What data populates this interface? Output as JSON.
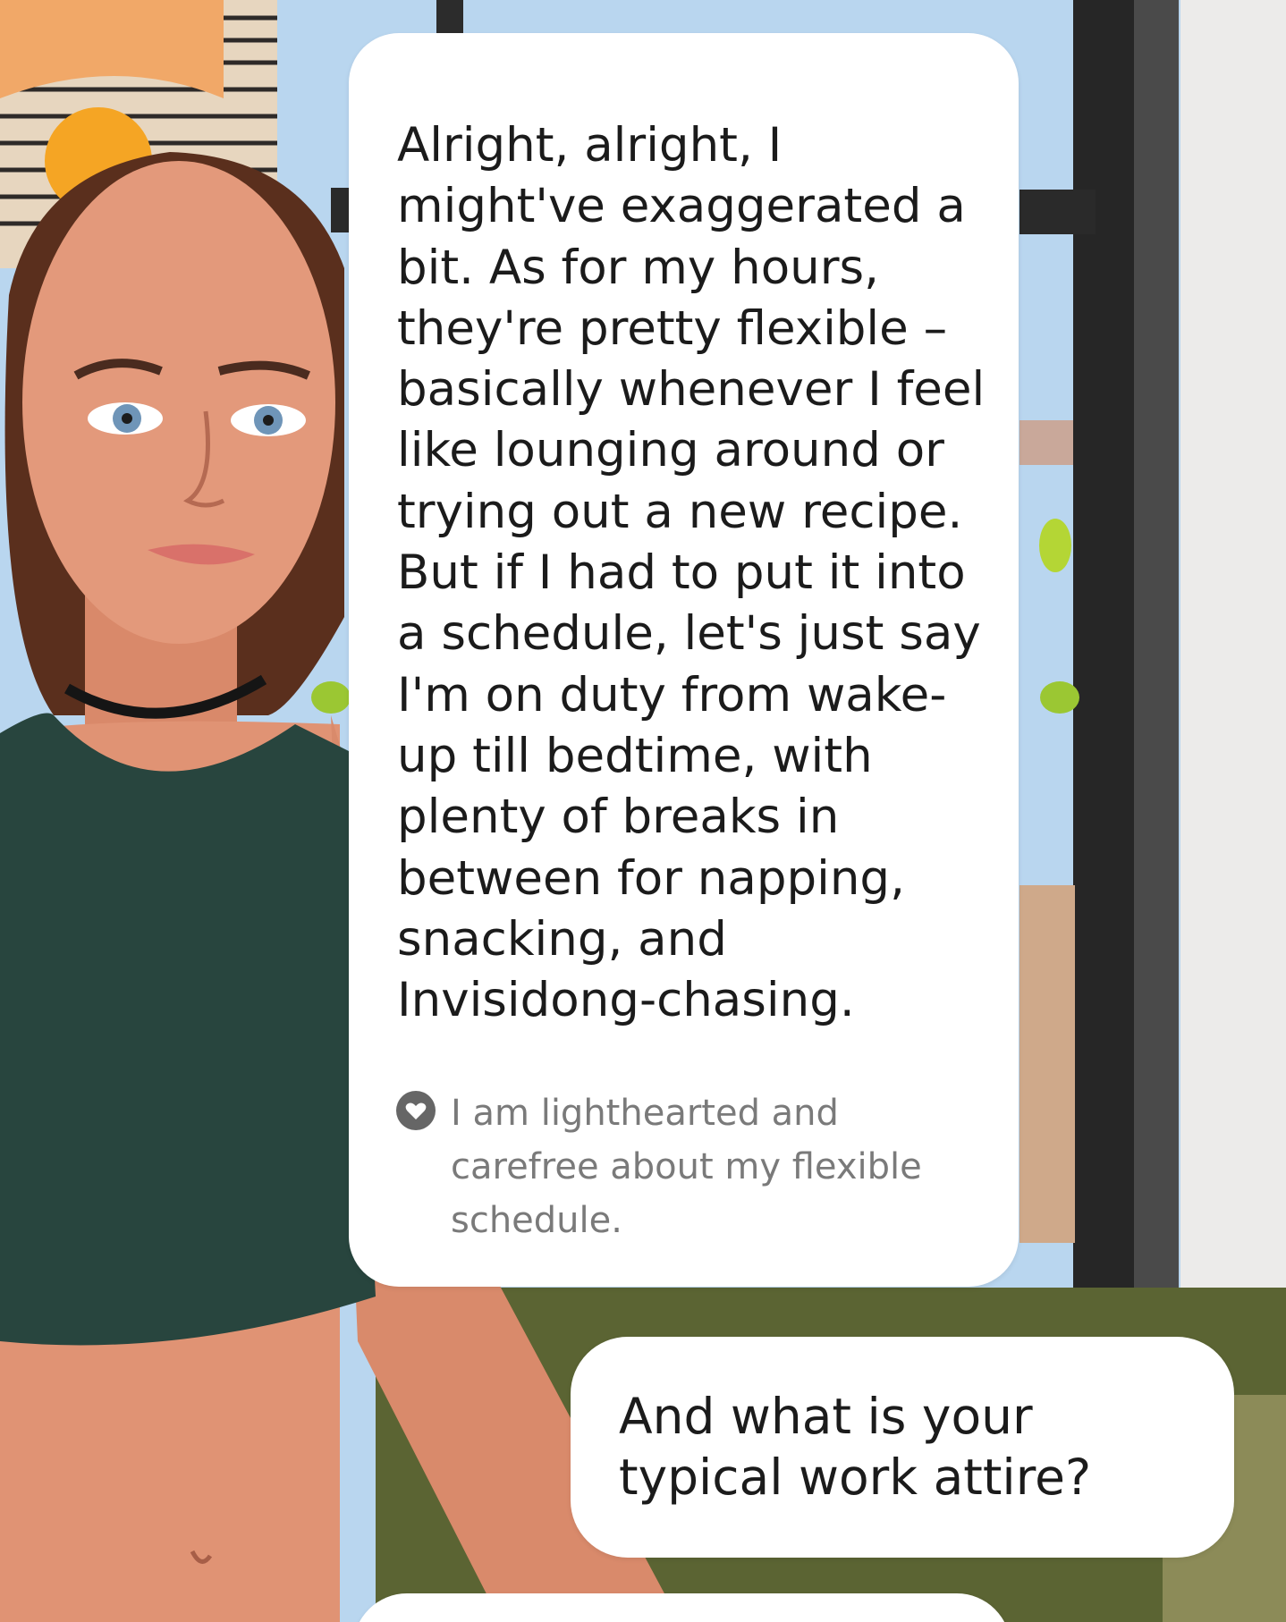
{
  "chat": {
    "avatar_message": "Alright, alright, I might've exaggerated a bit. As for my hours, they're pretty flexible – basically whenever I feel like lounging around or trying out a new recipe. But if I had to put it into a schedule, let's just say I'm on duty from wake-up till bedtime, with plenty of breaks in between for napping, snacking, and Invisidong-chasing.",
    "emotion_icon": "heart-icon",
    "emotion_text": "I am lighthearted and carefree about my flexible schedule.",
    "user_message": "And what is your typical work attire?"
  },
  "colors": {
    "bubble": "#ffffff",
    "message_text": "#1b1b1b",
    "emotion_text": "#7a7a7a",
    "icon": "#666666"
  }
}
